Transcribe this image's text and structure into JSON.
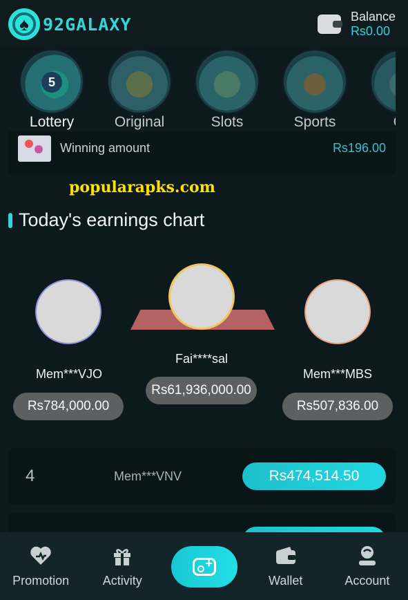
{
  "header": {
    "logo_text": "92GALAXY",
    "balance_label": "Balance",
    "balance_value": "Rs0.00"
  },
  "categories": [
    {
      "label": "Lottery",
      "icon": "lottery-balls-icon",
      "active": true
    },
    {
      "label": "Original",
      "icon": "original-games-icon",
      "active": false
    },
    {
      "label": "Slots",
      "icon": "slot-machine-icon",
      "active": false
    },
    {
      "label": "Sports",
      "icon": "sports-icon",
      "active": false
    },
    {
      "label": "Ca",
      "icon": "casino-icon",
      "active": false
    }
  ],
  "winning": {
    "label": "Winning amount",
    "amount": "Rs196.00"
  },
  "watermark": "popularapks.com",
  "earnings": {
    "title": "Today's earnings chart",
    "podium": [
      {
        "name": "Mem***VJO",
        "amount": "Rs784,000.00",
        "rank": 2
      },
      {
        "name": "Fai****sal",
        "amount": "Rs61,936,000.00",
        "rank": 1
      },
      {
        "name": "Mem***MBS",
        "amount": "Rs507,836.00",
        "rank": 3
      }
    ],
    "list": [
      {
        "rank": "4",
        "name": "Mem***VNV",
        "amount": "Rs474,514.50"
      }
    ]
  },
  "nav": {
    "items": [
      {
        "label": "Promotion",
        "icon": "promotion-icon"
      },
      {
        "label": "Activity",
        "icon": "gift-icon"
      },
      {
        "label": "",
        "icon": "gamepad-icon"
      },
      {
        "label": "Wallet",
        "icon": "wallet-icon"
      },
      {
        "label": "Account",
        "icon": "account-icon"
      }
    ]
  },
  "colors": {
    "background": "#0d1a1d",
    "accent": "#33d6d6",
    "pill_gray": "#5d6061",
    "podium_red": "#c86a6d"
  }
}
